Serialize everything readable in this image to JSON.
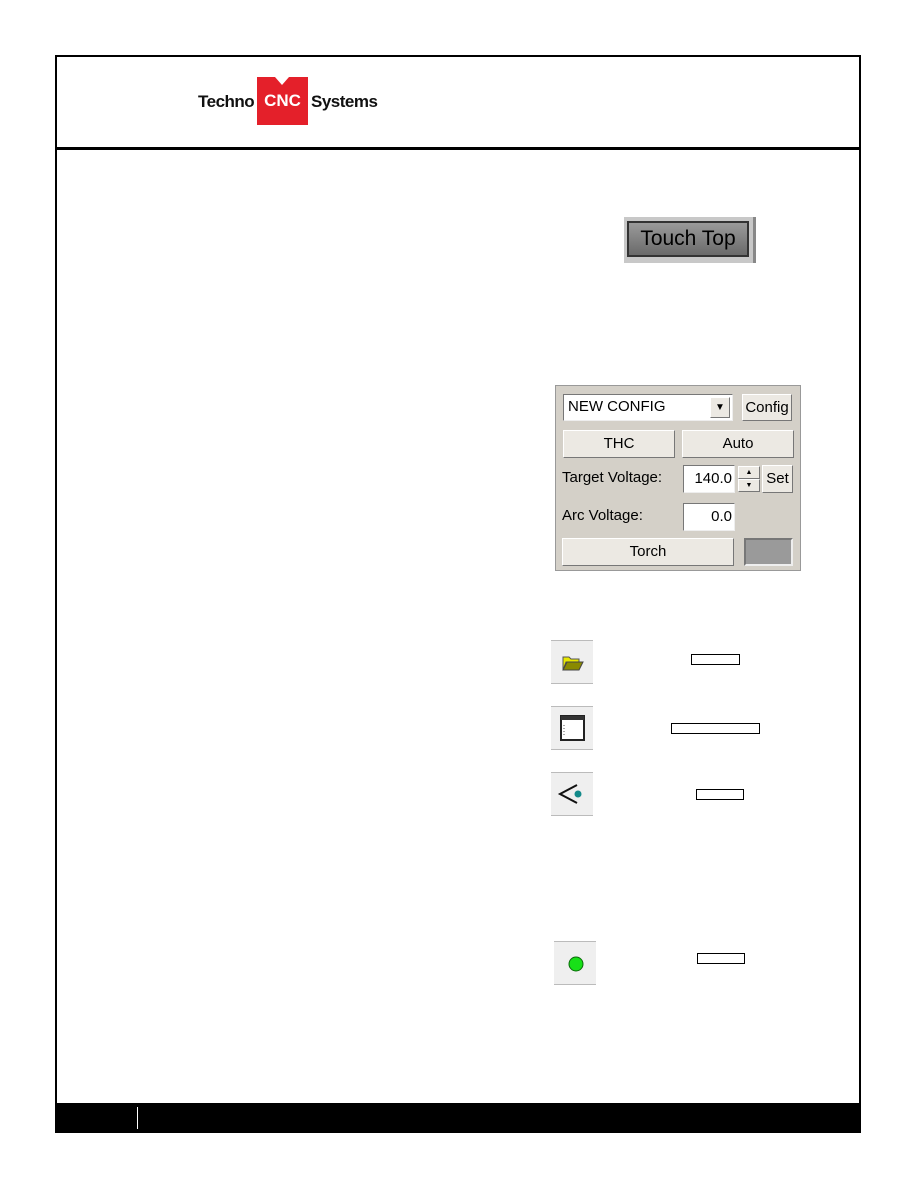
{
  "logo": {
    "left": "Techno",
    "mid": "CNC",
    "right": "Systems",
    "brand_red": "#e4202a"
  },
  "touch_top": {
    "label": "Touch Top"
  },
  "thc_panel": {
    "config_select": "NEW CONFIG",
    "config_button": "Config",
    "thc_button": "THC",
    "auto_button": "Auto",
    "target_label": "Target Voltage:",
    "target_value": "140.0",
    "set_button": "Set",
    "arc_label": "Arc Voltage:",
    "arc_value": "0.0",
    "torch_button": "Torch"
  },
  "icons": [
    "folder-open-icon",
    "window-icon",
    "eye-icon",
    "green-led-icon"
  ]
}
